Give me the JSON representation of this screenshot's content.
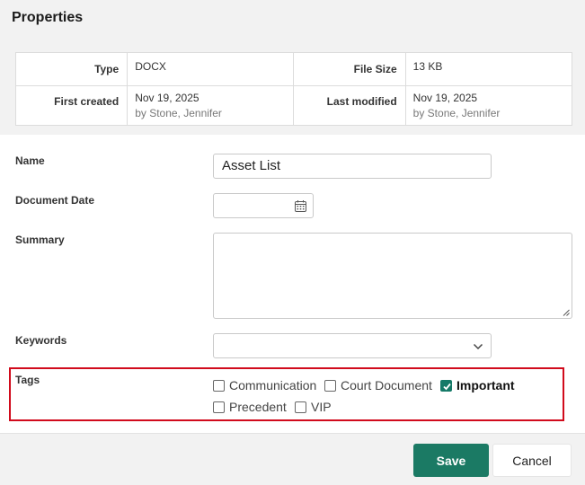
{
  "dialog": {
    "title": "Properties"
  },
  "info": {
    "type_label": "Type",
    "type_value": "DOCX",
    "filesize_label": "File Size",
    "filesize_value": "13 KB",
    "created_label": "First created",
    "created_date": "Nov 19, 2025",
    "created_by": "by Stone, Jennifer",
    "modified_label": "Last modified",
    "modified_date": "Nov 19, 2025",
    "modified_by": "by Stone, Jennifer"
  },
  "form": {
    "name_label": "Name",
    "name_value": "Asset List",
    "date_label": "Document Date",
    "date_value": "",
    "summary_label": "Summary",
    "summary_value": "",
    "keywords_label": "Keywords",
    "keywords_value": "",
    "tags_label": "Tags",
    "tags": [
      {
        "label": "Communication",
        "checked": false
      },
      {
        "label": "Court Document",
        "checked": false
      },
      {
        "label": "Important",
        "checked": true
      },
      {
        "label": "Precedent",
        "checked": false
      },
      {
        "label": "VIP",
        "checked": false
      }
    ]
  },
  "footer": {
    "save_label": "Save",
    "cancel_label": "Cancel"
  },
  "colors": {
    "accent": "#1b7a64",
    "highlight_frame": "#d10b1c"
  }
}
